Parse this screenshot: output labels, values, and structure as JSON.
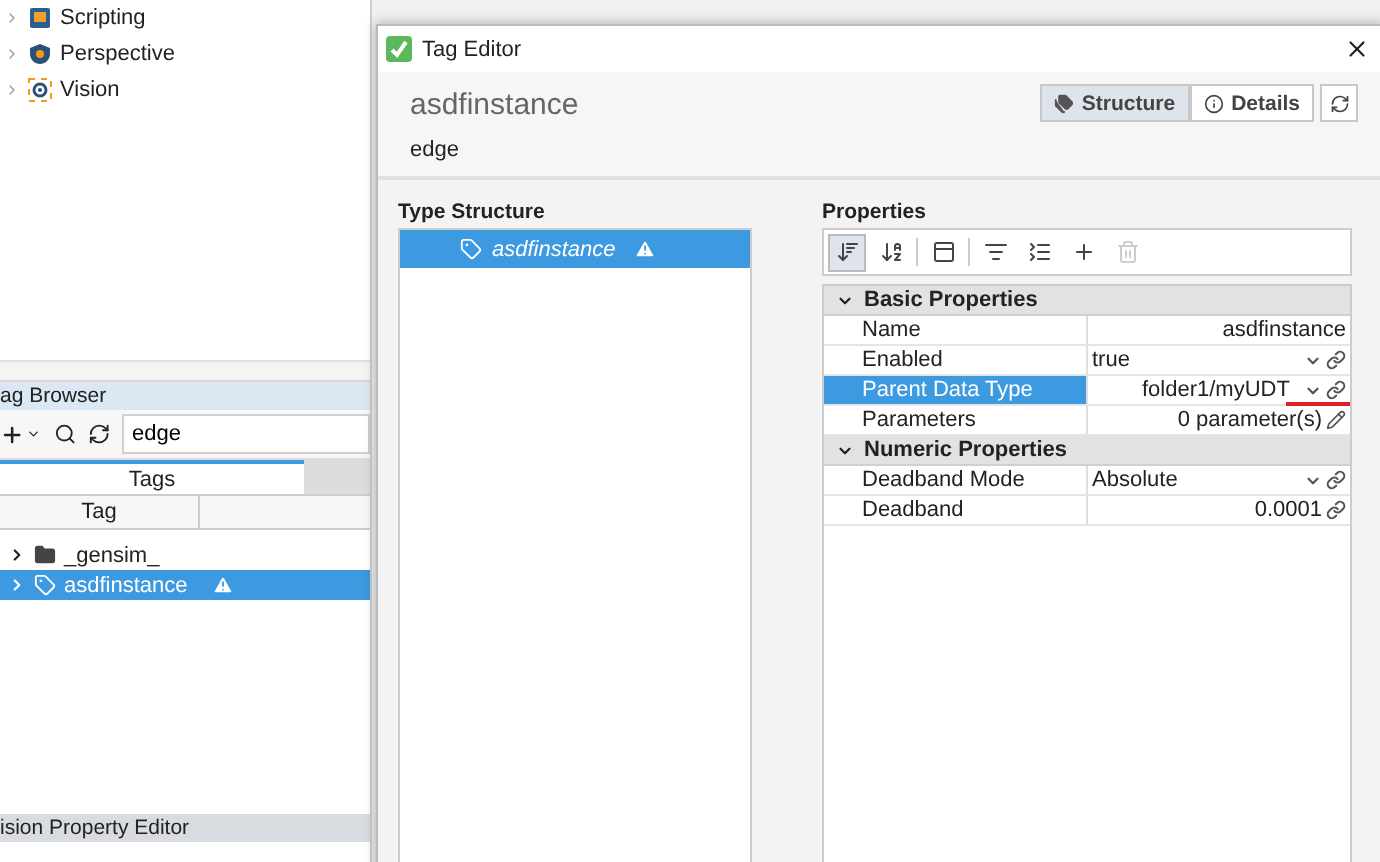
{
  "project_tree": {
    "items": [
      {
        "kind": "scripting",
        "label": "Scripting"
      },
      {
        "kind": "perspective",
        "label": "Perspective"
      },
      {
        "kind": "vision",
        "label": "Vision"
      }
    ]
  },
  "tag_browser": {
    "title": "ag Browser",
    "search": {
      "value": "edge"
    },
    "tabs": [
      {
        "label": "Tags",
        "selected": true
      }
    ],
    "columns": [
      "Tag"
    ],
    "rows": [
      {
        "kind": "folder",
        "label": "_gensim_",
        "selected": false,
        "warning": false
      },
      {
        "kind": "tag",
        "label": "asdfinstance",
        "selected": true,
        "warning": true
      }
    ]
  },
  "property_editor": {
    "title": "ision Property Editor"
  },
  "dialog": {
    "title": "Tag Editor",
    "name": "asdfinstance",
    "path": "edge",
    "views": [
      {
        "kind": "structure",
        "label": "Structure",
        "selected": true
      },
      {
        "kind": "details",
        "label": "Details",
        "selected": false
      }
    ],
    "type_structure": {
      "title": "Type Structure",
      "items": [
        {
          "label": "asdfinstance",
          "selected": true,
          "warning": true
        }
      ]
    },
    "properties": {
      "title": "Properties",
      "tools": [
        {
          "kind": "sort-group",
          "selected": true,
          "disabled": false
        },
        {
          "kind": "sort-alpha",
          "selected": false,
          "disabled": false
        },
        {
          "kind": "panel",
          "selected": false,
          "disabled": false
        },
        {
          "kind": "expand",
          "selected": false,
          "disabled": false
        },
        {
          "kind": "collapse",
          "selected": false,
          "disabled": false
        },
        {
          "kind": "add",
          "selected": false,
          "disabled": false
        },
        {
          "kind": "delete",
          "selected": false,
          "disabled": true
        }
      ],
      "groups": [
        {
          "title": "Basic Properties",
          "expanded": true,
          "rows": [
            {
              "kind": "text",
              "name": "Name",
              "value": "asdfinstance",
              "selected": false,
              "error": false
            },
            {
              "kind": "select",
              "name": "Enabled",
              "value": "true",
              "selected": false,
              "error": false
            },
            {
              "kind": "reference",
              "name": "Parent Data Type",
              "value": "folder1/myUDT",
              "selected": true,
              "error": true
            },
            {
              "kind": "editor",
              "name": "Parameters",
              "value": "0 parameter(s)",
              "selected": false,
              "error": false
            }
          ]
        },
        {
          "title": "Numeric Properties",
          "expanded": true,
          "rows": [
            {
              "kind": "select",
              "name": "Deadband Mode",
              "value": "Absolute",
              "selected": false,
              "error": false
            },
            {
              "kind": "number",
              "name": "Deadband",
              "value": "0.0001",
              "selected": false,
              "error": false
            }
          ]
        }
      ]
    }
  }
}
